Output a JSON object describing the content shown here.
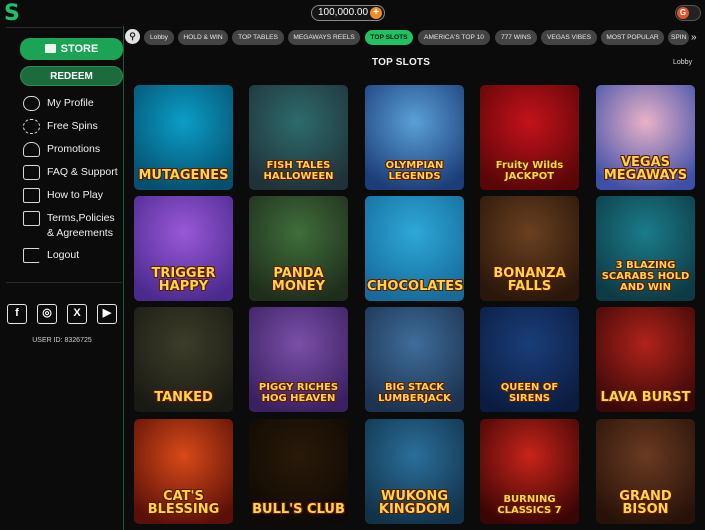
{
  "header": {
    "logo_text": "S",
    "balance": "100,000.00",
    "balance_plus": "+",
    "toggle_letter": "G"
  },
  "sidebar": {
    "store_label": "STORE",
    "redeem_label": "REDEEM",
    "menu": [
      {
        "label": "My Profile",
        "icon": "profile-icon"
      },
      {
        "label": "Free Spins",
        "icon": "refresh-icon"
      },
      {
        "label": "Promotions",
        "icon": "megaphone-icon"
      },
      {
        "label": "FAQ & Support",
        "icon": "chat-icon"
      },
      {
        "label": "How to Play",
        "icon": "play-icon"
      },
      {
        "label": "Terms,Policies & Agreements",
        "icon": "document-icon"
      },
      {
        "label": "Logout",
        "icon": "logout-icon"
      }
    ],
    "social": [
      "f",
      "◎",
      "X",
      "▶"
    ],
    "user_id": "USER ID: 8326725"
  },
  "tabs": [
    "Lobby",
    "HOLD & WIN",
    "TOP TABLES",
    "MEGAWAYS REELS",
    "TOP SLOTS",
    "AMERICA'S TOP 10",
    "777 WINS",
    "VEGAS VIBES",
    "MOST POPULAR",
    "SPIN"
  ],
  "active_tab": "TOP SLOTS",
  "tab_more": "»",
  "section": {
    "title": "TOP SLOTS",
    "lobby_link": "Lobby"
  },
  "games": [
    {
      "title": "MUTAGENES",
      "colors": [
        "#0a9ec7",
        "#064f6e"
      ]
    },
    {
      "title": "FISH TALES HALLOWEEN",
      "colors": [
        "#2d6b6d",
        "#203238"
      ]
    },
    {
      "title": "OLYMPIAN LEGENDS",
      "colors": [
        "#5aa0d8",
        "#1c3d78"
      ]
    },
    {
      "title": "Fruity Wilds JACKPOT",
      "colors": [
        "#c4121a",
        "#5a0608"
      ]
    },
    {
      "title": "VEGAS MEGAWAYS",
      "colors": [
        "#e9b2c8",
        "#3d4fa8"
      ]
    },
    {
      "title": "TRIGGER HAPPY",
      "colors": [
        "#9a58d8",
        "#4b2a8e"
      ]
    },
    {
      "title": "PANDA MONEY",
      "colors": [
        "#3f6e3a",
        "#1f2d1c"
      ]
    },
    {
      "title": "CHOCOLATES",
      "colors": [
        "#2da8d8",
        "#166b9a"
      ]
    },
    {
      "title": "BONANZA FALLS",
      "colors": [
        "#6a4020",
        "#2a160a"
      ]
    },
    {
      "title": "3 BLAZING SCARABS HOLD AND WIN",
      "colors": [
        "#1b7b8a",
        "#0d3a44"
      ]
    },
    {
      "title": "TANKED",
      "colors": [
        "#3d3d2a",
        "#1a1a14"
      ]
    },
    {
      "title": "PIGGY RICHES HOG HEAVEN",
      "colors": [
        "#7a4fa8",
        "#3a2060"
      ]
    },
    {
      "title": "BIG STACK LUMBERJACK",
      "colors": [
        "#3f6d9a",
        "#1c3250"
      ]
    },
    {
      "title": "QUEEN OF SIRENS",
      "colors": [
        "#1a3e7a",
        "#0b1c40"
      ]
    },
    {
      "title": "LAVA BURST",
      "colors": [
        "#b0231a",
        "#3a0808"
      ]
    },
    {
      "title": "CAT'S BLESSING",
      "colors": [
        "#d84a18",
        "#5a1008"
      ]
    },
    {
      "title": "BULL'S CLUB",
      "colors": [
        "#2a1a08",
        "#0e0904"
      ]
    },
    {
      "title": "WUKONG KINGDOM",
      "colors": [
        "#2a6f9a",
        "#12324a"
      ]
    },
    {
      "title": "BURNING CLASSICS 7",
      "colors": [
        "#c8241a",
        "#3a0505"
      ]
    },
    {
      "title": "GRAND BISON",
      "colors": [
        "#6a3a22",
        "#281208"
      ]
    }
  ]
}
